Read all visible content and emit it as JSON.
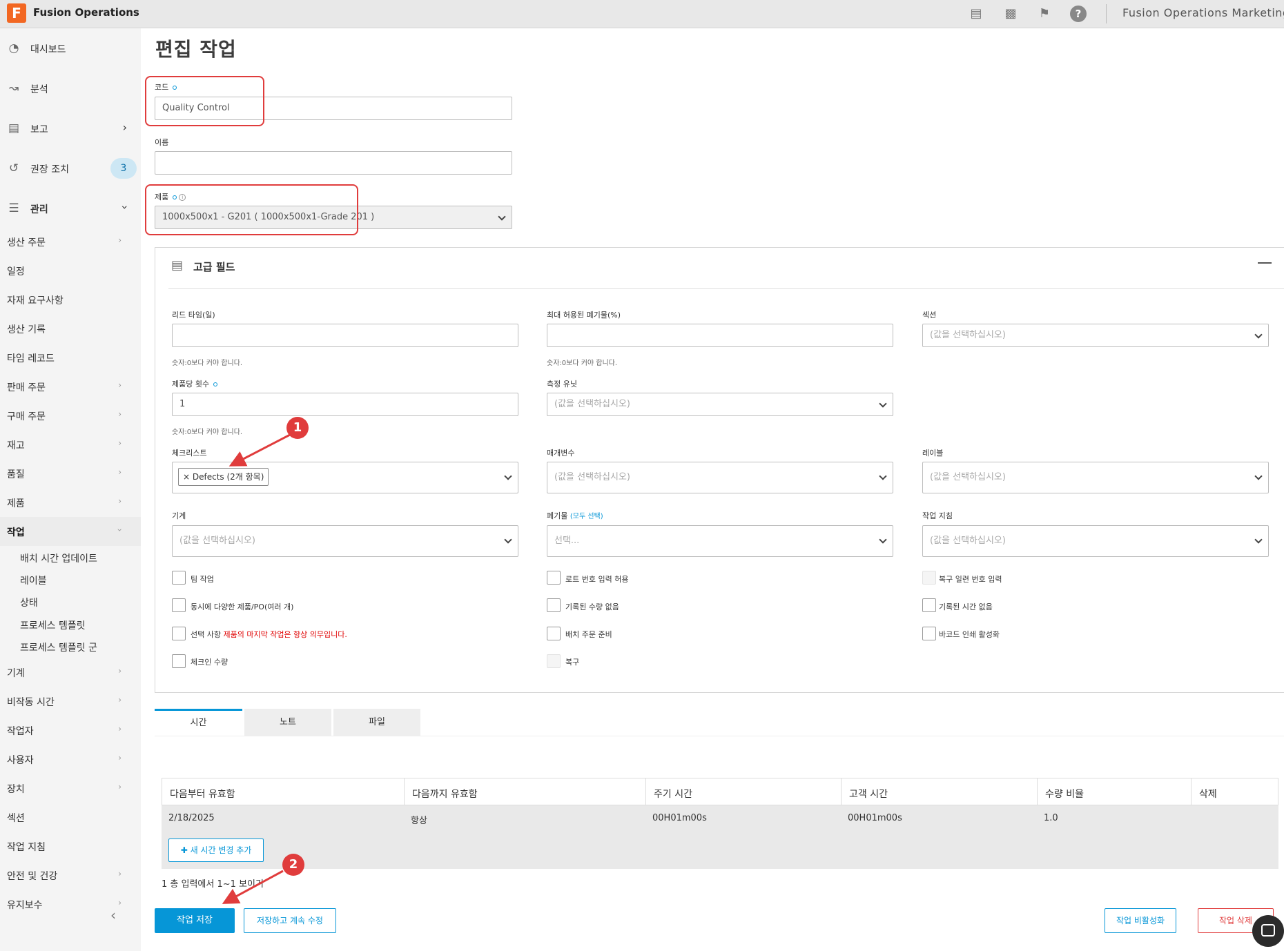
{
  "topbar": {
    "logo_letter": "F",
    "app_name": "Fusion Operations",
    "account_name": "Fusion Operations Marketing",
    "icons": [
      "chat-icon",
      "window-icon",
      "bookmark-icon",
      "help-icon"
    ]
  },
  "sidebar": {
    "main": [
      {
        "label": "대시보드",
        "icon": "dashboard-icon"
      },
      {
        "label": "분석",
        "icon": "analytics-icon"
      },
      {
        "label": "보고",
        "icon": "report-icon"
      },
      {
        "label": "권장 조치",
        "icon": "history-icon",
        "badge": "3"
      },
      {
        "label": "관리",
        "icon": "sliders-icon"
      }
    ],
    "sub": [
      "생산 주문",
      "일정",
      "자재 요구사항",
      "생산 기록",
      "타임 레코드",
      "판매 주문",
      "구매 주문",
      "재고",
      "품질",
      "제품",
      "작업"
    ],
    "children": [
      "배치 시간 업데이트",
      "레이블",
      "상태",
      "프로세스 템플릿",
      "프로세스 템플릿 군"
    ],
    "sub2": [
      "기계",
      "비작동 시간",
      "작업자",
      "사용자",
      "장치",
      "섹션",
      "작업 지침",
      "안전 및 건강",
      "유지보수"
    ]
  },
  "page": {
    "title": "편집 작업",
    "code_label": "코드",
    "code_value": "Quality Control",
    "name_label": "이름",
    "name_value": "",
    "product_label": "제품",
    "product_value": "1000x500x1 - G201 ( 1000x500x1-Grade 201 )"
  },
  "advanced": {
    "title": "고급 필드",
    "lead_time_label": "리드 타임(일)",
    "lead_time_hint": "숫자:0보다 커야 합니다.",
    "max_waste_label": "최대 허용된 폐기물(%)",
    "max_waste_hint": "숫자:0보다 커야 합니다.",
    "section_label": "섹션",
    "placeholder": "(값을 선택하십시오)",
    "per_product_label": "제품당 횟수",
    "per_product_value": "1",
    "per_product_hint": "숫자:0보다 커야 합니다.",
    "unit_label": "측정 유닛",
    "checklist_label": "체크리스트",
    "checklist_chip": "× Defects (2개 항목)",
    "param_label": "매개변수",
    "label_label": "레이블",
    "machine_label": "기계",
    "waste_label": "폐기물",
    "waste_select_all": "(모두 선택)",
    "waste_placeholder": "선택...",
    "instructions_label": "작업 지침",
    "checkboxes": {
      "team": "팀 작업",
      "lot_input": "로트 번호 입력 허용",
      "serial_recovery": "복구 일련 번호 입력",
      "multi_product": "동시에 다양한 제품/PO(여러 개)",
      "no_qty": "기록된 수량 없음",
      "no_time": "기록된 시간 없음",
      "optional_prefix": "선택 사항",
      "optional_red": "제품의 마지막 작업은 항상 의무입니다.",
      "batch_ready": "배치 주문 준비",
      "barcode": "바코드 인쇄 활성화",
      "checkin_qty": "체크인 수량",
      "recover": "복구"
    }
  },
  "tabs": [
    "시간",
    "노트",
    "파일"
  ],
  "time_table": {
    "headers": [
      "다음부터 유효함",
      "다음까지 유효함",
      "주기 시간",
      "고객 시간",
      "수량 비율",
      "삭제"
    ],
    "rows": [
      [
        "2/18/2025",
        "항상",
        "00H01m00s",
        "00H01m00s",
        "1.0",
        ""
      ]
    ],
    "add_label": "✚ 새 시간 변경 추가",
    "count_text": "1 총 입력에서 1~1 보이기"
  },
  "buttons": {
    "save": "작업 저장",
    "save_continue": "저장하고 계속 수정",
    "deactivate": "작업 비활성화",
    "delete": "작업 삭제"
  },
  "annotations": [
    "1",
    "2"
  ],
  "colors": {
    "accent": "#0696d7",
    "annotation": "#e03c3c",
    "brand": "#f26722"
  }
}
